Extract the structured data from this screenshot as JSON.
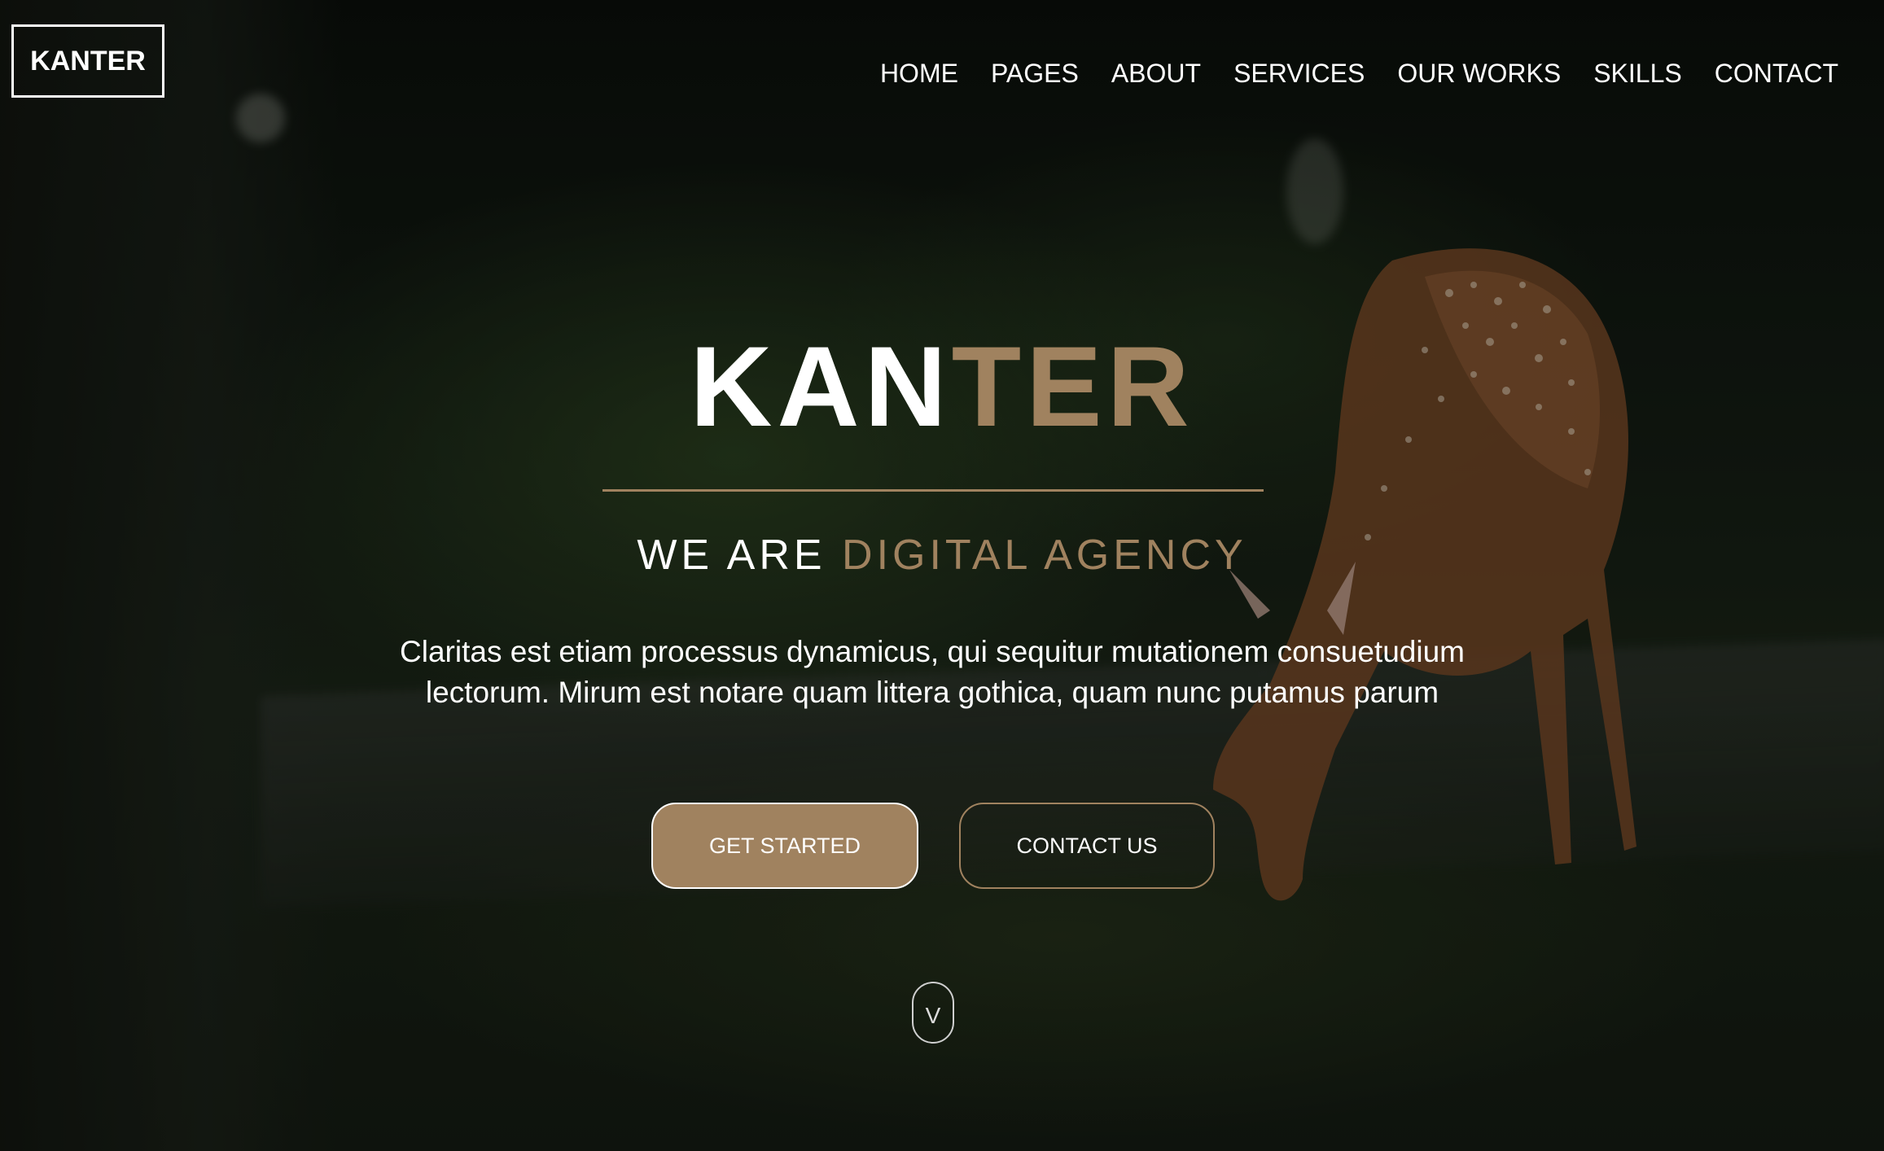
{
  "header": {
    "logo_text": "KANTER",
    "nav_items": [
      "HOME",
      "PAGES",
      "ABOUT",
      "SERVICES",
      "OUR WORKS",
      "SKILLS",
      "CONTACT"
    ]
  },
  "hero": {
    "title_part1": "KAN",
    "title_part2": "TER",
    "subtitle_part1": "WE ARE ",
    "subtitle_part2": "DIGITAL AGENCY",
    "description": "Claritas est etiam processus dynamicus, qui sequitur mutationem consuetudium lectorum. Mirum est notare quam littera gothica, quam nunc putamus parum",
    "primary_button": "GET STARTED",
    "secondary_button": "CONTACT US",
    "scroll_button_glyph": "V"
  },
  "colors": {
    "accent": "#a0825f",
    "text": "#ffffff"
  },
  "icons": {
    "scroll_down": "chevron-down-icon"
  }
}
